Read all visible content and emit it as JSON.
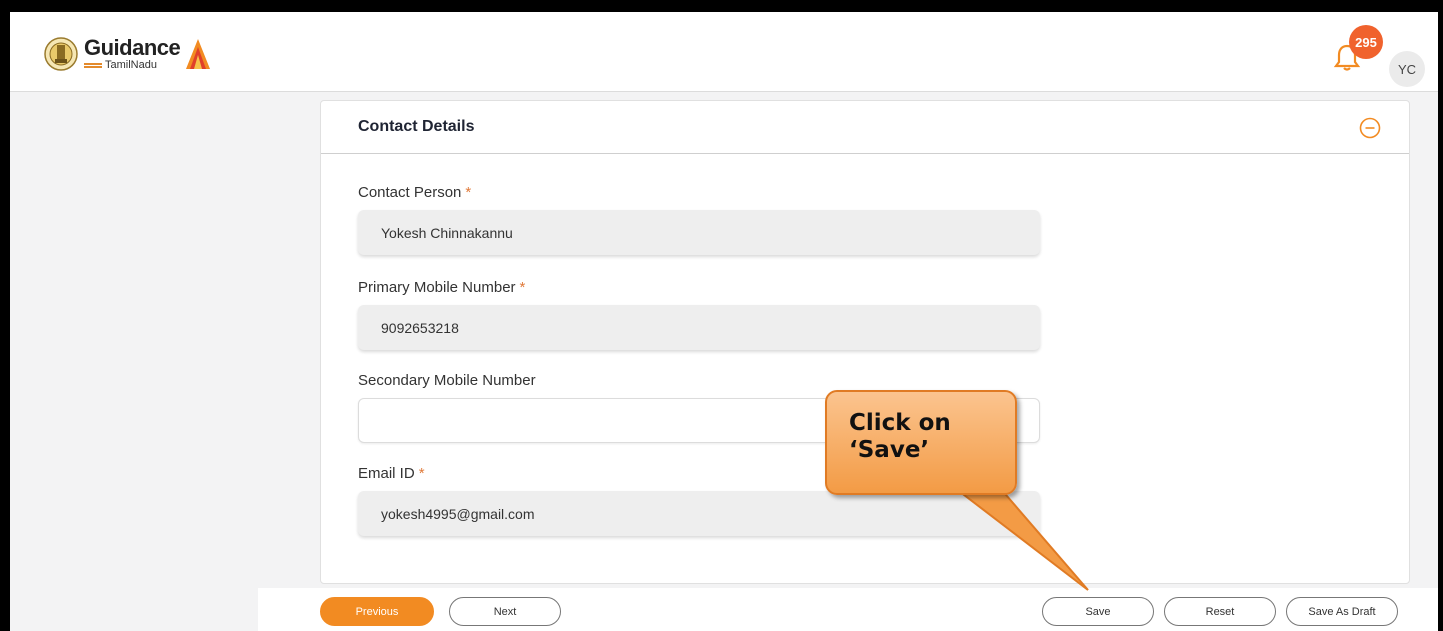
{
  "header": {
    "brand_main": "Guidance",
    "brand_sub": "TamilNadu",
    "notification_count": "295",
    "avatar_initials": "YC"
  },
  "section": {
    "title": "Contact Details",
    "fields": [
      {
        "label": "Contact Person",
        "required": "*",
        "value": "Yokesh Chinnakannu"
      },
      {
        "label": "Primary Mobile Number",
        "required": "*",
        "value": "9092653218"
      },
      {
        "label": "Secondary Mobile Number",
        "value": ""
      },
      {
        "label": "Email ID",
        "required": "*",
        "value": "yokesh4995@gmail.com"
      }
    ]
  },
  "footer": {
    "previous": "Previous",
    "next": "Next",
    "save": "Save",
    "reset": "Reset",
    "save_as_draft": "Save As Draft"
  },
  "callout": {
    "line1": "Click on",
    "line2": "‘Save’"
  },
  "colors": {
    "accent": "#f28b22",
    "notification_badge": "#f0622d",
    "required_marker": "#e07a3a",
    "callout_fill": "#f39b45"
  },
  "icons": [
    "tamilnadu-emblem-icon",
    "flame-logo-icon",
    "bell-icon",
    "minus-circle-icon"
  ]
}
